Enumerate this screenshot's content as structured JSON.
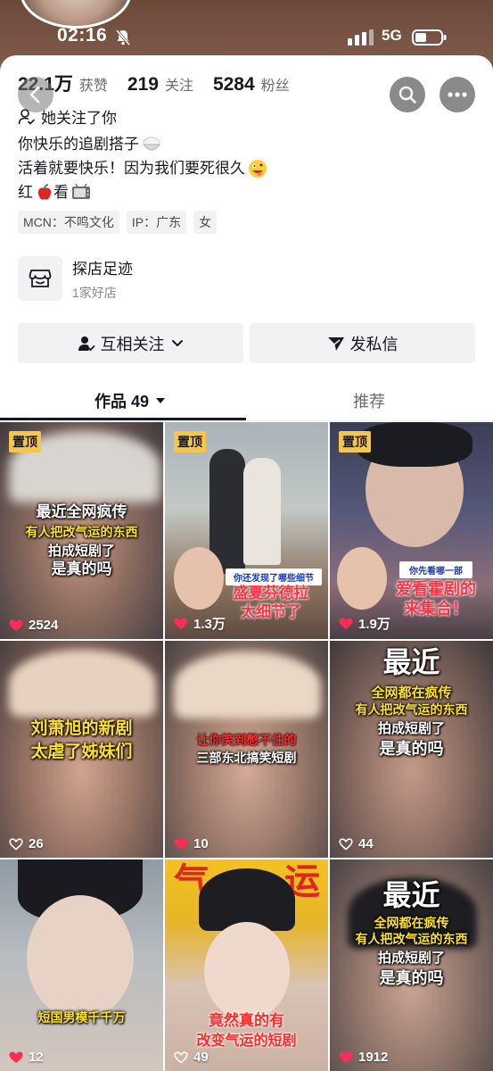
{
  "status_bar": {
    "time": "02:16",
    "network": "5G"
  },
  "stats": [
    {
      "value": "22.1万",
      "label": "获赞"
    },
    {
      "value": "219",
      "label": "关注"
    },
    {
      "value": "5284",
      "label": "粉丝"
    }
  ],
  "follows_you": "她关注了你",
  "bio": {
    "line1": "你快乐的追剧搭子",
    "line2": "活着就要快乐！因为我们要死很久",
    "line3_a": "红",
    "line3_b": "看"
  },
  "tags": [
    "MCN：不鸣文化",
    "IP：广东",
    "女"
  ],
  "shop": {
    "title": "探店足迹",
    "subtitle": "1家好店"
  },
  "buttons": {
    "mutual": "互相关注",
    "message": "发私信"
  },
  "tabs": {
    "works": "作品 49",
    "recommend": "推荐"
  },
  "grid": {
    "pinned_label": "置顶",
    "items": [
      {
        "likes": "2524",
        "caption_lines": [
          "最近全网疯传",
          "有人把改气运的东西",
          "拍成短剧了",
          "是真的吗"
        ]
      },
      {
        "likes": "1.3万",
        "sub": "你还发现了哪些细节",
        "caption_lines": [
          "盛夏芬德拉",
          "太细节了"
        ]
      },
      {
        "likes": "1.9万",
        "sub": "你先看哪一部",
        "caption_lines": [
          "爱看霍剧的",
          "来集合！"
        ]
      },
      {
        "likes": "26",
        "caption_lines": [
          "刘萧旭的新剧",
          "太虐了姊妹们"
        ]
      },
      {
        "likes": "10",
        "caption_lines": [
          "让你笑到憋不住的",
          "三部东北搞笑短剧"
        ]
      },
      {
        "likes": "44",
        "caption_lines": [
          "最近",
          "全网都在疯传",
          "有人把改气运的东西",
          "拍成短剧了",
          "是真的吗"
        ]
      },
      {
        "likes": "12",
        "caption_lines": [
          "短国男模千千万"
        ]
      },
      {
        "likes": "49",
        "top_text": [
          "气",
          "运"
        ],
        "caption_lines": [
          "竟然真的有",
          "改变气运的短剧"
        ]
      },
      {
        "likes": "1912",
        "caption_lines": [
          "最近",
          "全网都在疯传",
          "有人把改气运的东西",
          "拍成短剧了",
          "是真的吗"
        ]
      }
    ]
  }
}
